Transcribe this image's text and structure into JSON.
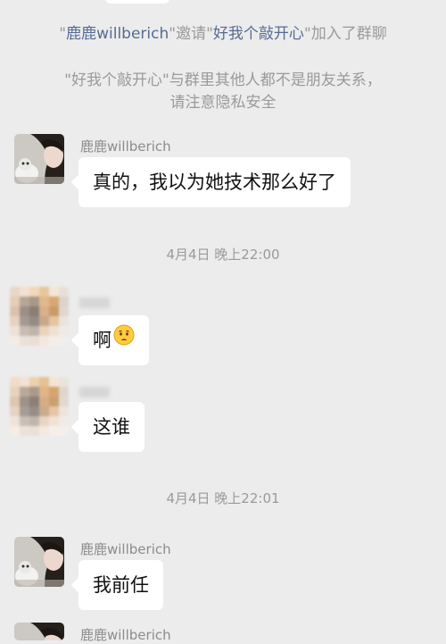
{
  "system": {
    "invite": {
      "q1": "\"",
      "inviter": "鹿鹿willberich",
      "q2": "\"邀请\"",
      "invitee": "好我个敲开心",
      "q3": "\"加入了群聊"
    },
    "privacy_line1": "\"好我个敲开心\"与群里其他人都不是朋友关系，",
    "privacy_line2": "请注意隐私安全"
  },
  "messages": [
    {
      "sender": "鹿鹿willberich",
      "text": "真的，我以为她技术那么好了"
    },
    {
      "timestamp": "4月4日 晚上22:00"
    },
    {
      "sender": "",
      "text": "啊",
      "emoji": "anguished-face-emoji"
    },
    {
      "sender": "",
      "text": "这谁"
    },
    {
      "timestamp": "4月4日 晚上22:01"
    },
    {
      "sender": "鹿鹿willberich",
      "text": "我前任"
    },
    {
      "sender": "鹿鹿willberich"
    }
  ],
  "colors": {
    "background": "#ececec",
    "bubble": "#ffffff",
    "system_text": "#9a9a9a",
    "system_link": "#566b94",
    "sender_text": "#8c8c8c"
  }
}
